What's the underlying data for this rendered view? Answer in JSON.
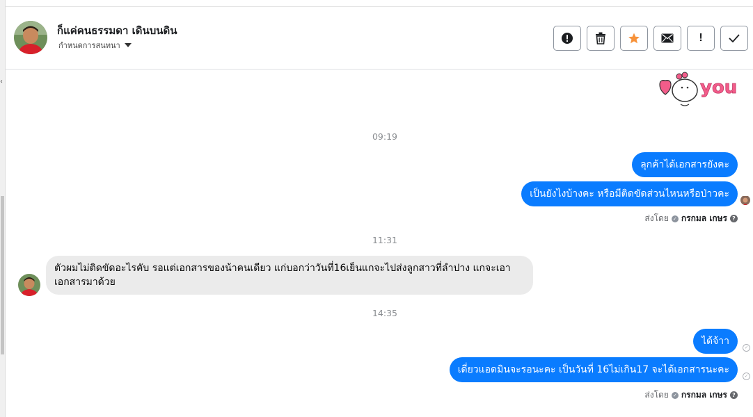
{
  "header": {
    "title": "ก็แค่คนธรรมดา เดินบนดิน",
    "assign_label": "กำหนดการสนทนา",
    "actions": [
      {
        "name": "spam-button",
        "icon": "alert-circle-icon"
      },
      {
        "name": "delete-button",
        "icon": "trash-icon"
      },
      {
        "name": "star-button",
        "icon": "star-icon"
      },
      {
        "name": "mark-unread-button",
        "icon": "envelope-icon"
      },
      {
        "name": "mark-important-button",
        "icon": "exclamation-icon"
      },
      {
        "name": "mark-done-button",
        "icon": "check-icon"
      }
    ]
  },
  "sticker": {
    "text": "you"
  },
  "messages": {
    "time_1": "09:19",
    "out_1": "ลุกค้าได้เอกสารยังคะ",
    "out_2": "เป็นยังไงบ้างคะ หรือมีติดขัดส่วนไหนหรือป่าวคะ",
    "sent_by_label": "ส่งโดย",
    "sent_by_name": "กรกมล เกษร",
    "time_2": "11:31",
    "in_1": "ตัวผมไม่ติดขัดอะไรคับ รอแต่เอกสารของน้าคนเดียว แก่บอกว่าวันที่16เย็นแกจะไปส่งลูกสาวที่ลำปาง แกจะเอาเอกสารมาด้วย",
    "time_3": "14:35",
    "out_3": "ได้จ้าา",
    "out_4": "เดี่ยวแอดมินจะรอนะคะ  เป็นวันที่ 16ไม่เกิน17 จะได้เอกสารนะคะ",
    "sent_by_label_2": "ส่งโดย",
    "sent_by_name_2": "กรกมล เกษร"
  },
  "colors": {
    "outgoing_bubble": "#0a7cff",
    "incoming_bubble": "#ebebeb",
    "star": "#f7923a",
    "sticker_pink": "#f25c8a"
  }
}
